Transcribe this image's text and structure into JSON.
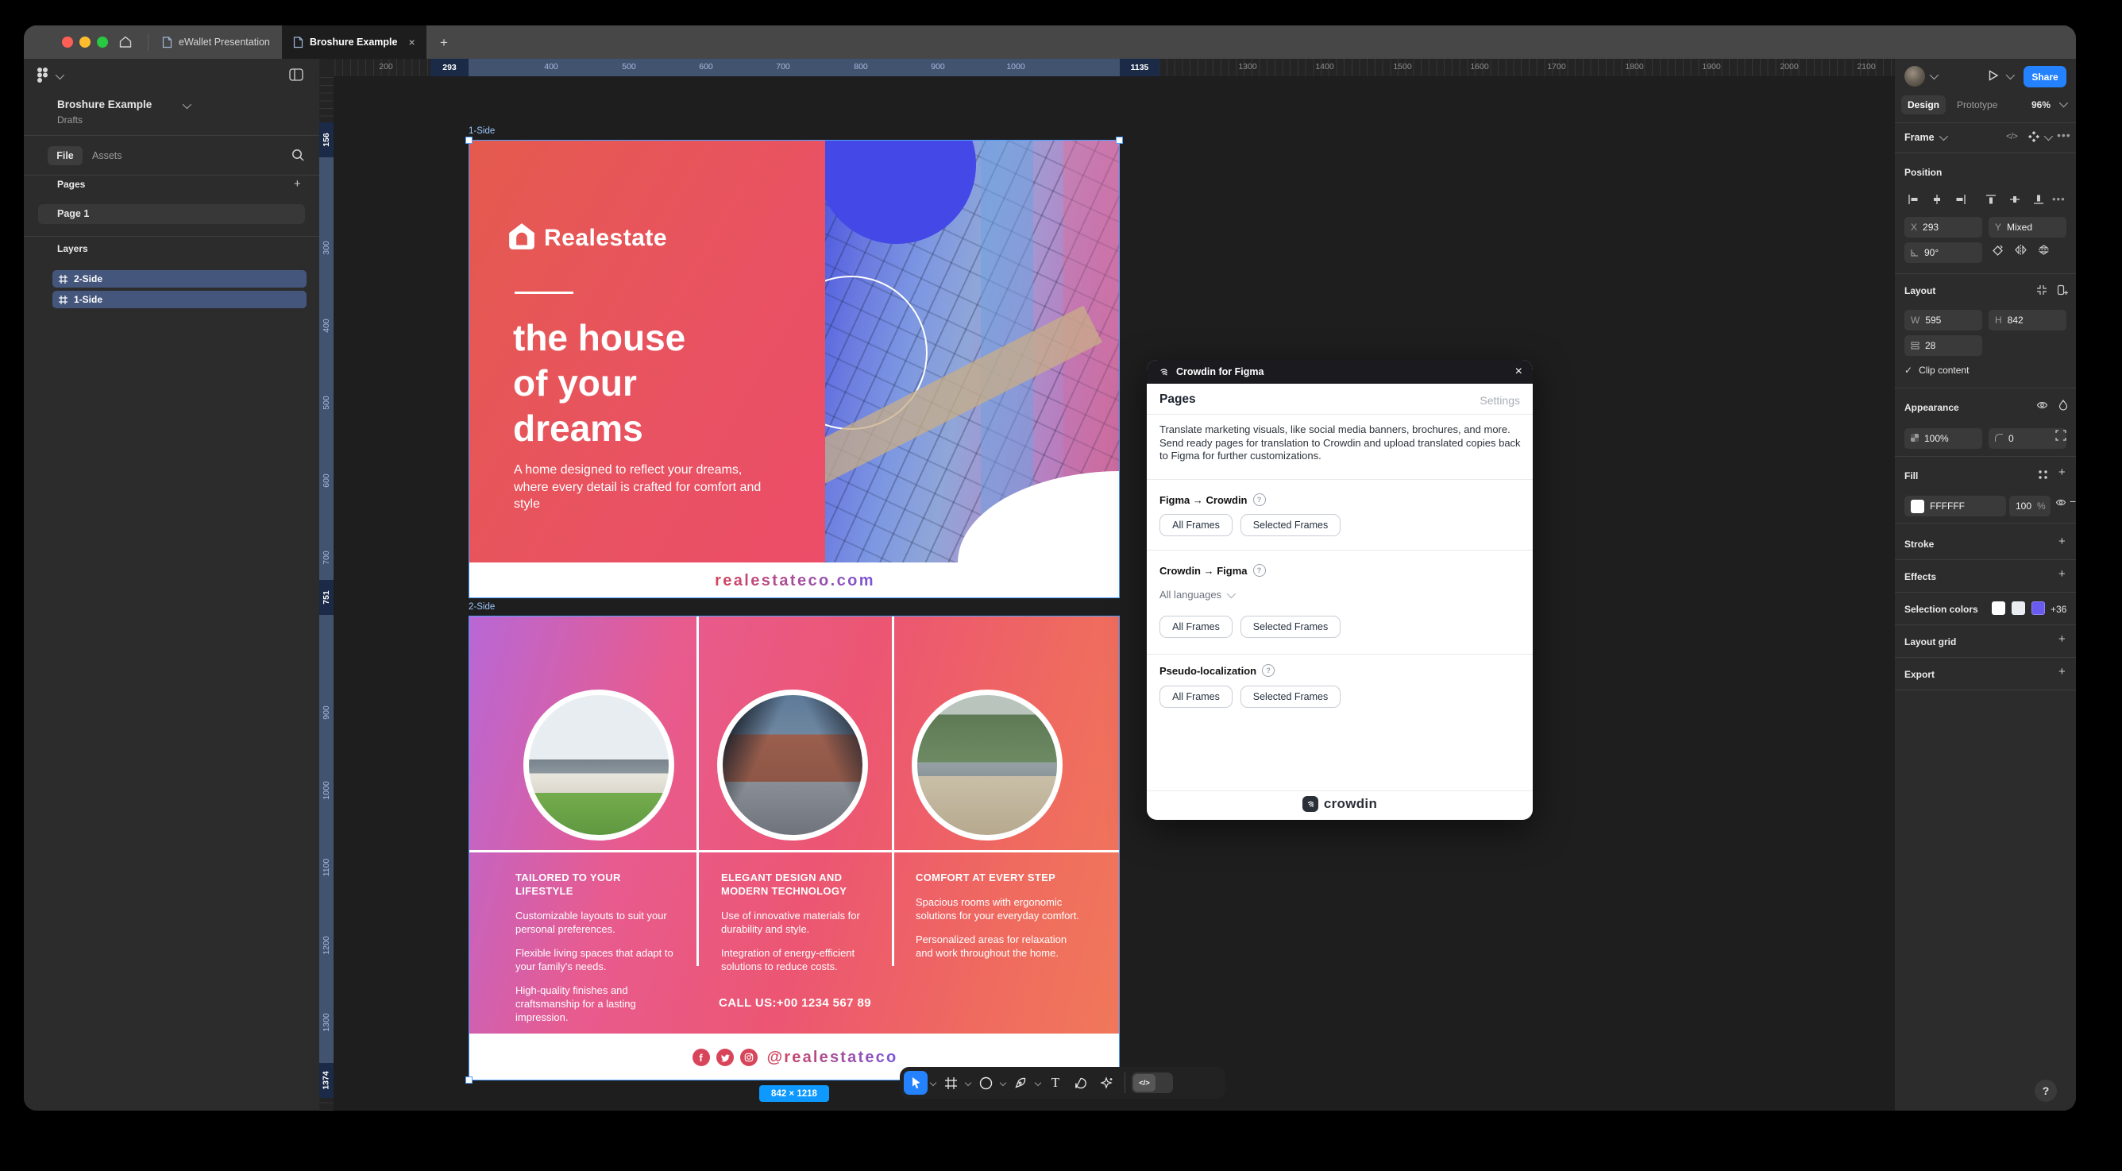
{
  "topbar": {
    "tabs": [
      {
        "label": "eWallet Presentation"
      },
      {
        "label": "Broshure Example"
      }
    ]
  },
  "sidebar": {
    "doc_title": "Broshure Example",
    "doc_location": "Drafts",
    "tab_file": "File",
    "tab_assets": "Assets",
    "pages_label": "Pages",
    "page_items": [
      "Page 1"
    ],
    "layers_label": "Layers",
    "layer_items": [
      "2-Side",
      "1-Side"
    ]
  },
  "inspector": {
    "share_label": "Share",
    "tab_design": "Design",
    "tab_prototype": "Prototype",
    "zoom_level": "96%",
    "selection_type": "Frame",
    "position": {
      "header": "Position",
      "x_label": "X",
      "x_value": "293",
      "y_label": "Y",
      "y_value": "Mixed",
      "rotation_value": "90°"
    },
    "layout": {
      "header": "Layout",
      "w_label": "W",
      "w_value": "595",
      "h_label": "H",
      "h_value": "842",
      "gap_value": "28",
      "clip_label": "Clip content"
    },
    "appearance": {
      "header": "Appearance",
      "opacity_value": "100%",
      "radius_value": "0"
    },
    "fill": {
      "header": "Fill",
      "hex": "FFFFFF",
      "opacity": "100",
      "unit": "%"
    },
    "stroke_header": "Stroke",
    "effects_header": "Effects",
    "selection_colors": {
      "header": "Selection colors",
      "overflow": "+36"
    },
    "layout_grid_header": "Layout grid",
    "export_header": "Export"
  },
  "plugin": {
    "title": "Crowdin for Figma",
    "nav_pages": "Pages",
    "nav_settings": "Settings",
    "description": "Translate marketing visuals, like social media banners, brochures, and more. Send ready pages for translation to Crowdin and upload translated copies back to Figma for further customizations.",
    "section1_title": "Figma → Crowdin",
    "section2_title": "Crowdin → Figma",
    "section3_title": "Pseudo-localization",
    "language_filter": "All languages",
    "btn_all_frames": "All Frames",
    "btn_selected_frames": "Selected Frames",
    "brand": "crowdin"
  },
  "canvas": {
    "frame1_label": "1-Side",
    "frame2_label": "2-Side",
    "size_badge": "842 × 1218",
    "ruler_h": [
      "200",
      "293",
      "400",
      "500",
      "600",
      "700",
      "800",
      "900",
      "1000",
      "1135",
      "1300",
      "1400",
      "1500",
      "1600",
      "1700",
      "1800",
      "1900",
      "2000",
      "2100"
    ],
    "ruler_v": [
      "156",
      "300",
      "400",
      "500",
      "600",
      "700",
      "751",
      "900",
      "1000",
      "1100",
      "1200",
      "1300",
      "1374"
    ]
  },
  "brochure1": {
    "brand": "Realestate",
    "heading_lines": [
      "the house",
      "of your",
      "dreams"
    ],
    "subtext": "A home designed to reflect your dreams, where every detail is crafted for comfort and style",
    "website": "realestateco.com"
  },
  "brochure2": {
    "columns": [
      {
        "title": "TAILORED TO YOUR LIFESTYLE",
        "paras": [
          "Customizable layouts to suit your personal preferences.",
          "Flexible living spaces that adapt to your family's needs.",
          "High-quality finishes and craftsmanship for a lasting impression."
        ]
      },
      {
        "title": "ELEGANT DESIGN AND MODERN TECHNOLOGY",
        "paras": [
          "Use of innovative materials for durability and style.",
          "Integration of energy-efficient solutions to reduce costs."
        ]
      },
      {
        "title": "COMFORT AT EVERY STEP",
        "paras": [
          "Spacious rooms with ergonomic solutions for your everyday comfort.",
          "Personalized areas for relaxation and work throughout the home."
        ]
      }
    ],
    "call_us": "CALL US:+00 1234 567 89",
    "social_handle": "@realestateco"
  },
  "colors": {
    "accent_blue": "#2482ff",
    "figma_blue": "#0d99ff",
    "brand_red": "#e4574f",
    "brand_purple": "#7a55d8",
    "selection_swatches": [
      "#ffffff",
      "#e9edf2",
      "#6a5bf0"
    ]
  }
}
